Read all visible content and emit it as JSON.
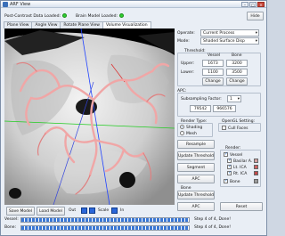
{
  "window": {
    "title": "ARF View"
  },
  "status": {
    "post_contrast_label": "Post-Contrast Data Loaded:",
    "brain_model_label": "Brain Model Loaded:"
  },
  "hide_label": "Hide",
  "tabs": [
    {
      "label": "Plane View",
      "active": false
    },
    {
      "label": "Angle View",
      "active": false
    },
    {
      "label": "Rotate Plane View",
      "active": false
    },
    {
      "label": "Volume Visualization",
      "active": true
    }
  ],
  "panel": {
    "operate_label": "Operate:",
    "operate_value": "Current Process",
    "mode_label": "Mode:",
    "mode_value": "Shaded Surface Disp",
    "threshold_label": "Threshold:",
    "col_vessel": "Vessel",
    "col_bone": "Bone",
    "upper_label": "Upper:",
    "upper_vessel": "1673",
    "upper_bone": "3200",
    "lower_label": "Lower:",
    "lower_vessel": "1100",
    "lower_bone": "3500",
    "change_label": "Change",
    "apc_label": "APC:",
    "subsampling_label": "Subsampling Factor:",
    "subsampling_value": "1",
    "count_a": "79542",
    "count_b": "966576",
    "render_type_label": "Render Type:",
    "shading_label": "Shading",
    "mesh_label": "Mesh",
    "opengl_label": "OpenGL Setting:",
    "cull_faces_label": "Cull Faces",
    "resample_label": "Resample",
    "update_threshold_label": "Update Threshold",
    "segment_label": "Segment",
    "apc_button_label": "APC",
    "bone_label": "Bone",
    "render_label": "Render:",
    "render_items": [
      {
        "label": "Vessel",
        "checked": true,
        "color": null
      },
      {
        "label": "Basilar A.",
        "checked": true,
        "color": "#d4a0a0"
      },
      {
        "label": "Lt. ICA",
        "checked": true,
        "color": "#d06060"
      },
      {
        "label": "Rt. ICA",
        "checked": true,
        "color": "#c04848"
      },
      {
        "label": "Bone",
        "checked": true,
        "color": "#9a9a9a"
      }
    ],
    "reset_label": "Reset"
  },
  "viewport_bottom": {
    "save_model": "Save Model",
    "load_model": "Load Model",
    "out_label": "Out",
    "scale_label": "Scale",
    "in_label": "In"
  },
  "progress": [
    {
      "label": "Vessel:",
      "percent": 100,
      "status": "Step 4 of 4, Done!"
    },
    {
      "label": "Bone:",
      "percent": 100,
      "status": "Step 4 of 4, Done!"
    }
  ]
}
